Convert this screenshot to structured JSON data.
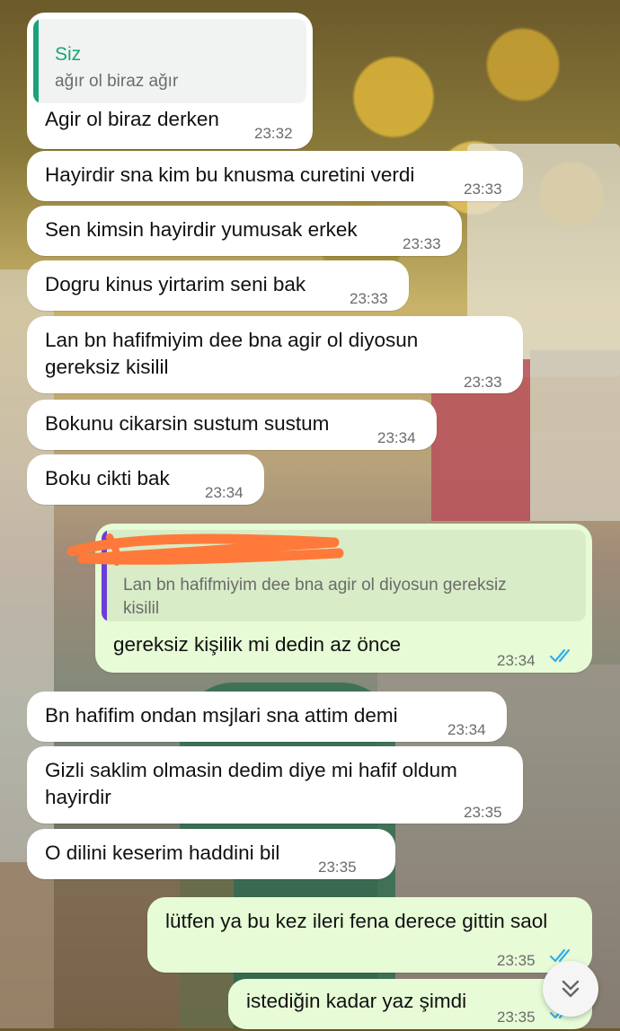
{
  "colors": {
    "incoming_bg": "#ffffff",
    "outgoing_bg": "#e6fbd6",
    "quote_own_accent": "#1aa37a",
    "quote_other_accent": "#6b3fd6",
    "read_ticks": "#34aee8",
    "scribble": "#ff7a3a"
  },
  "messages": [
    {
      "direction": "incoming",
      "quote": {
        "author": "Siz",
        "text": "ağır ol biraz ağır"
      },
      "lines": [
        "Agir ol biraz derken"
      ],
      "time": "23:32"
    },
    {
      "direction": "incoming",
      "lines": [
        "Hayirdir sna kim bu knusma curetini verdi"
      ],
      "time": "23:33"
    },
    {
      "direction": "incoming",
      "lines": [
        "Sen kimsin hayirdir yumusak erkek"
      ],
      "time": "23:33"
    },
    {
      "direction": "incoming",
      "lines": [
        "Dogru kinus yirtarim seni bak"
      ],
      "time": "23:33"
    },
    {
      "direction": "incoming",
      "lines": [
        "Lan bn hafifmiyim dee bna agir ol diyosun",
        "gereksiz kisilil"
      ],
      "time": "23:33"
    },
    {
      "direction": "incoming",
      "lines": [
        "Bokunu cikarsin sustum sustum"
      ],
      "time": "23:34"
    },
    {
      "direction": "incoming",
      "lines": [
        "Boku cikti bak"
      ],
      "time": "23:34"
    },
    {
      "direction": "outgoing",
      "quote": {
        "author_redacted": true,
        "lines": [
          "Lan bn hafifmiyim dee bna agir ol diyosun gereksiz",
          "kisilil"
        ]
      },
      "lines": [
        "gereksiz kişilik mi dedin az önce"
      ],
      "time": "23:34",
      "status": "read"
    },
    {
      "direction": "incoming",
      "lines": [
        "Bn hafifim ondan msjlari sna attim demi"
      ],
      "time": "23:34"
    },
    {
      "direction": "incoming",
      "lines": [
        "Gizli saklim olmasin dedim diye mi hafif oldum",
        "hayirdir"
      ],
      "time": "23:35"
    },
    {
      "direction": "incoming",
      "lines": [
        "O dilini keserim haddini bil"
      ],
      "time": "23:35"
    },
    {
      "direction": "outgoing",
      "lines": [
        "lütfen ya bu kez ileri fena derece gittin saol"
      ],
      "time": "23:35",
      "status": "read"
    },
    {
      "direction": "outgoing",
      "lines": [
        "istediğin kadar yaz şimdi"
      ],
      "time": "23:35",
      "status": "read"
    }
  ],
  "scroll_button": {
    "icon": "double-chevron-down-icon"
  }
}
